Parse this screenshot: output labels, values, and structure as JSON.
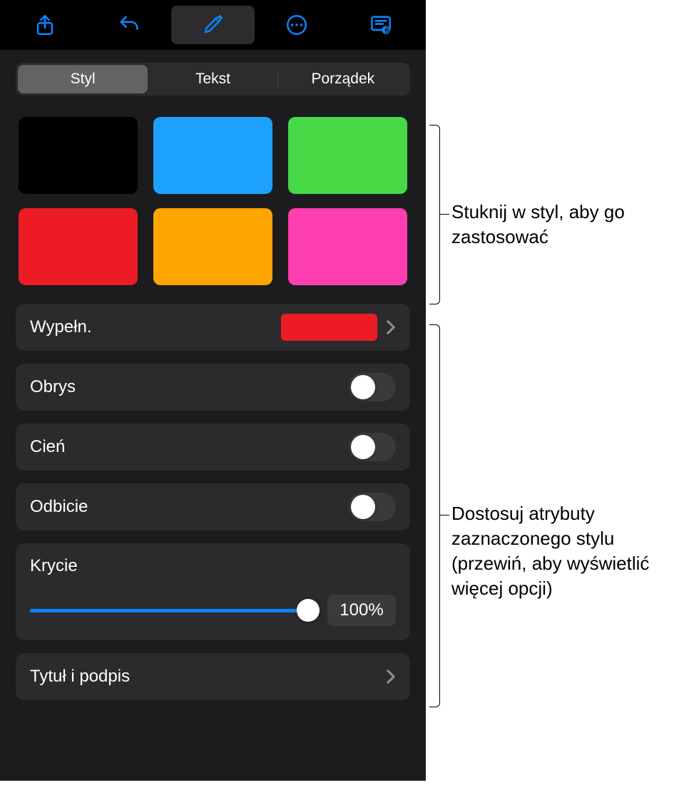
{
  "toolbar": {
    "icons": [
      "share-icon",
      "undo-icon",
      "format-icon",
      "more-icon",
      "presenter-icon"
    ],
    "active_index": 2
  },
  "tabs": {
    "items": [
      "Styl",
      "Tekst",
      "Porządek"
    ],
    "selected_index": 0
  },
  "styles": {
    "swatches": [
      "#000000",
      "#1DA1FF",
      "#47D945",
      "#ED1C24",
      "#FFA500",
      "#FF3FB1"
    ]
  },
  "rows": {
    "fill": {
      "label": "Wypełn.",
      "preview_color": "#ED1C24"
    },
    "border": {
      "label": "Obrys",
      "on": false
    },
    "shadow": {
      "label": "Cień",
      "on": false
    },
    "reflection": {
      "label": "Odbicie",
      "on": false
    },
    "opacity": {
      "label": "Krycie",
      "value_text": "100%",
      "percent": 100
    },
    "title": {
      "label": "Tytuł i podpis"
    }
  },
  "callouts": {
    "c1": "Stuknij w styl, aby go zastosować",
    "c2": "Dostosuj atrybuty zaznaczonego stylu (przewiń, aby wyświetlić więcej opcji)"
  }
}
